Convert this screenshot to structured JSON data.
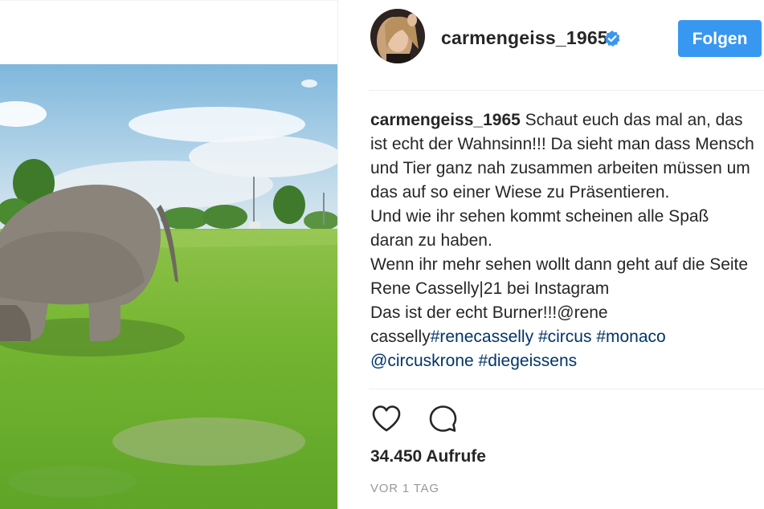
{
  "post": {
    "username": "carmengeiss_1965",
    "follow_label": "Folgen",
    "caption": {
      "user": "carmengeiss_1965",
      "text_1": " Schaut euch das mal an, das ist echt der Wahnsinn!!! Da sieht man dass Mensch und Tier ganz nah zusammen arbeiten müssen um das auf so einer Wiese zu Präsentieren.",
      "text_2": "Und wie ihr sehen kommt scheinen alle Spaß daran zu haben.",
      "text_3": "Wenn ihr mehr sehen wollt dann geht auf die Seite Rene Casselly|21 bei Instagram",
      "text_4": "Das ist der echt Burner!!!@rene casselly",
      "hashtag_1": "#renecasselly",
      "hashtag_2": "#circus",
      "hashtag_3": "#monaco",
      "mention_1": "@circuskrone",
      "hashtag_4": "#diegeissens"
    },
    "views": "34.450 Aufrufe",
    "timestamp": "VOR 1 TAG"
  },
  "icons": {
    "verified": "verified-badge-icon",
    "like": "heart-icon",
    "comment": "comment-icon"
  },
  "colors": {
    "follow_button": "#3897f0",
    "verified_badge": "#3897f0",
    "hashtag": "#003569",
    "timestamp": "#999999"
  }
}
